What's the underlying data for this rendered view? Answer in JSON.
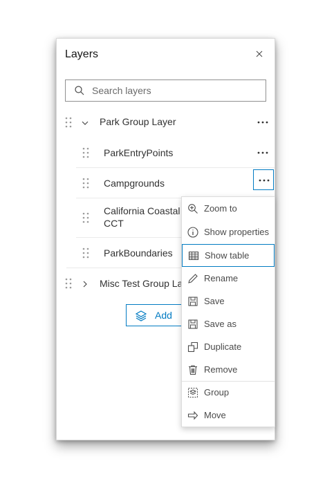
{
  "panel": {
    "title": "Layers",
    "close_icon": "close-icon"
  },
  "search": {
    "placeholder": "Search layers",
    "value": ""
  },
  "layers": [
    {
      "label": "Park Group Layer",
      "expanded": true,
      "group": true
    },
    {
      "label": "ParkEntryPoints"
    },
    {
      "label": "Campgrounds",
      "menu_open": true
    },
    {
      "label_line1": "California Coastal",
      "label_line2": "CCT"
    },
    {
      "label": "ParkBoundaries"
    },
    {
      "label": "Misc Test Group Layer",
      "expanded": false,
      "group": true
    }
  ],
  "add_button": {
    "label": "Add"
  },
  "menu": {
    "items": [
      {
        "label": "Zoom to",
        "icon": "zoom-in-icon"
      },
      {
        "label": "Show properties",
        "icon": "info-icon"
      },
      {
        "label": "Show table",
        "icon": "table-icon"
      },
      {
        "label": "Rename",
        "icon": "pencil-icon"
      },
      {
        "label": "Save",
        "icon": "save-icon"
      },
      {
        "label": "Save as",
        "icon": "save-as-icon"
      },
      {
        "label": "Duplicate",
        "icon": "duplicate-icon"
      },
      {
        "label": "Remove",
        "icon": "trash-icon"
      },
      {
        "label": "Group",
        "icon": "group-icon"
      },
      {
        "label": "Move",
        "icon": "move-arrow-icon"
      }
    ]
  },
  "colors": {
    "accent": "#007ac2",
    "text": "#323232",
    "border": "#8f8f8f"
  }
}
